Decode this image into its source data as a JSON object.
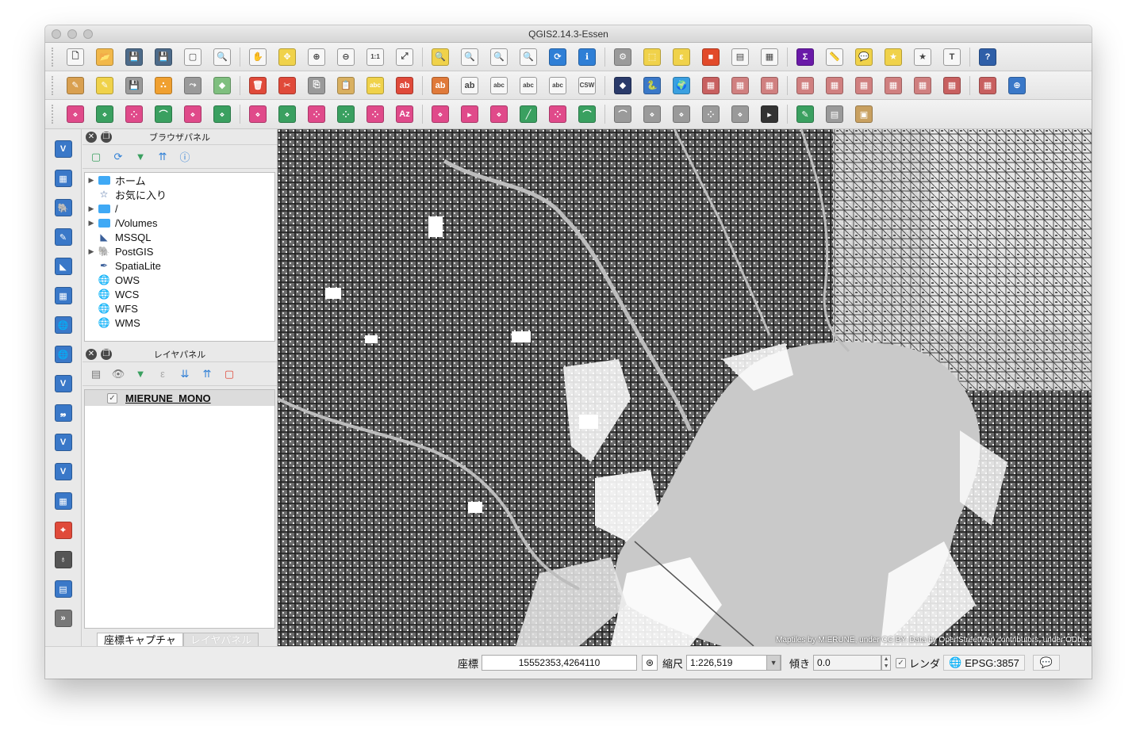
{
  "window": {
    "title": "QGIS2.14.3-Essen"
  },
  "toolbars": {
    "row1": [
      {
        "name": "new-project-icon",
        "glyph": "🗋",
        "color": "#ffffff"
      },
      {
        "name": "open-project-icon",
        "glyph": "📂",
        "color": "#f2b84a"
      },
      {
        "name": "save-project-icon",
        "glyph": "💾",
        "color": "#4d6b8a"
      },
      {
        "name": "save-as-icon",
        "glyph": "💾",
        "color": "#4d6b8a"
      },
      {
        "name": "new-print-composer-icon",
        "glyph": "▢",
        "color": "#ffffff"
      },
      {
        "name": "composer-manager-icon",
        "glyph": "🔍",
        "color": "#ffffff"
      },
      {
        "name": "pan-icon",
        "glyph": "✋",
        "color": "#ffffff"
      },
      {
        "name": "pan-to-selection-icon",
        "glyph": "✥",
        "color": "#f0d24a"
      },
      {
        "name": "zoom-in-icon",
        "glyph": "⊕",
        "color": "#ffffff"
      },
      {
        "name": "zoom-out-icon",
        "glyph": "⊖",
        "color": "#ffffff"
      },
      {
        "name": "zoom-native-icon",
        "glyph": "1:1",
        "color": "#ffffff"
      },
      {
        "name": "zoom-full-icon",
        "glyph": "⤢",
        "color": "#ffffff"
      },
      {
        "name": "zoom-to-selection-icon",
        "glyph": "🔍",
        "color": "#f0d24a"
      },
      {
        "name": "zoom-to-layer-icon",
        "glyph": "🔍",
        "color": "#ffffff"
      },
      {
        "name": "zoom-last-icon",
        "glyph": "🔍",
        "color": "#ffffff"
      },
      {
        "name": "zoom-next-icon",
        "glyph": "🔍",
        "color": "#ffffff"
      },
      {
        "name": "refresh-icon",
        "glyph": "⟳",
        "color": "#2f7fd6"
      },
      {
        "name": "identify-icon",
        "glyph": "ℹ",
        "color": "#2f7fd6"
      },
      {
        "name": "action-icon",
        "glyph": "⚙",
        "color": "#9a9a9a"
      },
      {
        "name": "select-features-icon",
        "glyph": "⬚",
        "color": "#f0d24a"
      },
      {
        "name": "select-by-expression-icon",
        "glyph": "ε",
        "color": "#f0d24a"
      },
      {
        "name": "deselect-icon",
        "glyph": "■",
        "color": "#e24a2a"
      },
      {
        "name": "attribute-table-icon",
        "glyph": "▤",
        "color": "#ffffff"
      },
      {
        "name": "field-calculator-icon",
        "glyph": "▦",
        "color": "#ffffff"
      },
      {
        "name": "statistics-icon",
        "glyph": "Σ",
        "color": "#6a1aa8"
      },
      {
        "name": "measure-icon",
        "glyph": "📏",
        "color": "#ffffff"
      },
      {
        "name": "map-tips-icon",
        "glyph": "💬",
        "color": "#f0d24a"
      },
      {
        "name": "new-bookmark-icon",
        "glyph": "★",
        "color": "#f0d24a"
      },
      {
        "name": "show-bookmarks-icon",
        "glyph": "★",
        "color": "#ffffff"
      },
      {
        "name": "text-annotation-icon",
        "glyph": "T",
        "color": "#ffffff"
      },
      {
        "name": "help-icon",
        "glyph": "?",
        "color": "#2f5fa8"
      }
    ],
    "row2": [
      {
        "name": "toggle-editing-icon",
        "glyph": "✎",
        "color": "#d9a050"
      },
      {
        "name": "current-edits-icon",
        "glyph": "✎",
        "color": "#f0d24a"
      },
      {
        "name": "save-edits-icon",
        "glyph": "💾",
        "color": "#9a9a9a"
      },
      {
        "name": "add-feature-icon",
        "glyph": "∴",
        "color": "#f0a030"
      },
      {
        "name": "move-feature-icon",
        "glyph": "⤳",
        "color": "#9a9a9a"
      },
      {
        "name": "node-tool-icon",
        "glyph": "◆",
        "color": "#7fbf7f"
      },
      {
        "name": "delete-selected-icon",
        "glyph": "🗑",
        "color": "#e04a3a"
      },
      {
        "name": "cut-features-icon",
        "glyph": "✂",
        "color": "#e04a3a"
      },
      {
        "name": "copy-features-icon",
        "glyph": "⎘",
        "color": "#9a9a9a"
      },
      {
        "name": "paste-features-icon",
        "glyph": "📋",
        "color": "#d9b060"
      },
      {
        "name": "label-toolbar-icon",
        "glyph": "abc",
        "color": "#f0d24a"
      },
      {
        "name": "label-highlight-icon",
        "glyph": "ab",
        "color": "#e04a3a"
      },
      {
        "name": "label-pin-icon",
        "glyph": "ab",
        "color": "#e07a3a"
      },
      {
        "name": "label-show-icon",
        "glyph": "ab",
        "color": "#ffffff"
      },
      {
        "name": "label-move-icon",
        "glyph": "abc",
        "color": "#ffffff"
      },
      {
        "name": "label-rotate-icon",
        "glyph": "abc",
        "color": "#ffffff"
      },
      {
        "name": "label-change-icon",
        "glyph": "abc",
        "color": "#ffffff"
      },
      {
        "name": "csw-icon",
        "glyph": "CSW",
        "color": "#ffffff"
      },
      {
        "name": "plugin-stamp-icon",
        "glyph": "◆",
        "color": "#2a3a6a"
      },
      {
        "name": "python-console-icon",
        "glyph": "🐍",
        "color": "#3a78c8"
      },
      {
        "name": "globe-plugin-icon",
        "glyph": "🌍",
        "color": "#3aa0e0"
      },
      {
        "name": "raster-plugin-1-icon",
        "glyph": "▦",
        "color": "#c86060"
      },
      {
        "name": "raster-plugin-2-icon",
        "glyph": "▦",
        "color": "#d08080"
      },
      {
        "name": "raster-plugin-3-icon",
        "glyph": "▦",
        "color": "#d08080"
      },
      {
        "name": "raster-plugin-4-icon",
        "glyph": "▦",
        "color": "#d08080"
      },
      {
        "name": "raster-plugin-5-icon",
        "glyph": "▦",
        "color": "#d08080"
      },
      {
        "name": "raster-plugin-6-icon",
        "glyph": "▦",
        "color": "#d08080"
      },
      {
        "name": "raster-plugin-7-icon",
        "glyph": "▦",
        "color": "#d08080"
      },
      {
        "name": "raster-plugin-8-icon",
        "glyph": "▦",
        "color": "#d08080"
      },
      {
        "name": "raster-plugin-9-icon",
        "glyph": "▦",
        "color": "#c86060"
      },
      {
        "name": "raster-plugin-10-icon",
        "glyph": "▦",
        "color": "#c86060"
      },
      {
        "name": "web-plugin-icon",
        "glyph": "⊕",
        "color": "#3a78c8"
      }
    ],
    "row3": [
      {
        "name": "digitize-1-icon",
        "glyph": "⋄",
        "color": "#e04a8a"
      },
      {
        "name": "digitize-2-icon",
        "glyph": "⋄",
        "color": "#3aa060"
      },
      {
        "name": "digitize-3-icon",
        "glyph": "⁘",
        "color": "#e04a8a"
      },
      {
        "name": "digitize-4-icon",
        "glyph": "⌒",
        "color": "#3aa060"
      },
      {
        "name": "digitize-5-icon",
        "glyph": "⋄",
        "color": "#e04a8a"
      },
      {
        "name": "digitize-6-icon",
        "glyph": "⋄",
        "color": "#3aa060"
      },
      {
        "name": "digitize-7-icon",
        "glyph": "⋄",
        "color": "#e04a8a"
      },
      {
        "name": "digitize-8-icon",
        "glyph": "⋄",
        "color": "#3aa060"
      },
      {
        "name": "digitize-9-icon",
        "glyph": "⁘",
        "color": "#e04a8a"
      },
      {
        "name": "digitize-10-icon",
        "glyph": "⁘",
        "color": "#3aa060"
      },
      {
        "name": "digitize-11-icon",
        "glyph": "⁘",
        "color": "#e04a8a"
      },
      {
        "name": "digitize-12-icon",
        "glyph": "Az",
        "color": "#e04a8a"
      },
      {
        "name": "digitize-13-icon",
        "glyph": "⋄",
        "color": "#e04a8a"
      },
      {
        "name": "digitize-14-icon",
        "glyph": "▸",
        "color": "#e04a8a"
      },
      {
        "name": "digitize-15-icon",
        "glyph": "⋄",
        "color": "#e04a8a"
      },
      {
        "name": "digitize-16-icon",
        "glyph": "╱",
        "color": "#3aa060"
      },
      {
        "name": "digitize-17-icon",
        "glyph": "⁘",
        "color": "#e04a8a"
      },
      {
        "name": "digitize-18-icon",
        "glyph": "⌒",
        "color": "#3aa060"
      },
      {
        "name": "digitize-19-icon",
        "glyph": "⌒",
        "color": "#9a9a9a"
      },
      {
        "name": "digitize-20-icon",
        "glyph": "⋄",
        "color": "#9a9a9a"
      },
      {
        "name": "digitize-21-icon",
        "glyph": "⋄",
        "color": "#9a9a9a"
      },
      {
        "name": "digitize-22-icon",
        "glyph": "⁘",
        "color": "#9a9a9a"
      },
      {
        "name": "digitize-23-icon",
        "glyph": "⋄",
        "color": "#9a9a9a"
      },
      {
        "name": "terminal-icon",
        "glyph": "▸",
        "color": "#333333"
      },
      {
        "name": "georeferencer-icon",
        "glyph": "✎",
        "color": "#3aa060"
      },
      {
        "name": "raster-terrain-icon",
        "glyph": "▤",
        "color": "#9a9a9a"
      },
      {
        "name": "image-icon",
        "glyph": "▣",
        "color": "#c8a060"
      }
    ],
    "left": [
      {
        "name": "add-vector-layer-icon",
        "glyph": "V",
        "color": "#3a78c8"
      },
      {
        "name": "add-raster-layer-icon",
        "glyph": "▦",
        "color": "#3a78c8"
      },
      {
        "name": "add-postgis-layer-icon",
        "glyph": "🐘",
        "color": "#3a78c8"
      },
      {
        "name": "add-spatialite-layer-icon",
        "glyph": "✎",
        "color": "#3a78c8"
      },
      {
        "name": "add-mssql-layer-icon",
        "glyph": "◣",
        "color": "#3a78c8"
      },
      {
        "name": "add-oracle-layer-icon",
        "glyph": "▦",
        "color": "#3a78c8"
      },
      {
        "name": "add-wms-layer-icon",
        "glyph": "🌐",
        "color": "#3a78c8"
      },
      {
        "name": "add-wcs-layer-icon",
        "glyph": "🌐",
        "color": "#3a78c8"
      },
      {
        "name": "add-wfs-layer-icon",
        "glyph": "V",
        "color": "#3a78c8"
      },
      {
        "name": "add-delimited-text-layer-icon",
        "glyph": "❠",
        "color": "#3a78c8"
      },
      {
        "name": "add-virtual-layer-icon",
        "glyph": "V",
        "color": "#3a78c8"
      },
      {
        "name": "new-shapefile-layer-icon",
        "glyph": "V",
        "color": "#3a78c8"
      },
      {
        "name": "new-spatialite-layer-icon",
        "glyph": "▦",
        "color": "#3a78c8"
      },
      {
        "name": "coordinate-capture-icon",
        "glyph": "⌖",
        "color": "#e04a3a"
      },
      {
        "name": "gps-tool-icon",
        "glyph": "♁",
        "color": "#555555"
      },
      {
        "name": "db-manager-icon",
        "glyph": "▤",
        "color": "#3a78c8"
      },
      {
        "name": "more-tools-chevron-icon",
        "glyph": "»",
        "color": "#777777"
      }
    ]
  },
  "browser_panel": {
    "title": "ブラウザパネル",
    "items": [
      {
        "label": "ホーム",
        "expandable": true,
        "icon": "folder-icon"
      },
      {
        "label": "お気に入り",
        "expandable": false,
        "icon": "star-icon"
      },
      {
        "label": "/",
        "expandable": true,
        "icon": "folder-icon"
      },
      {
        "label": "/Volumes",
        "expandable": true,
        "icon": "folder-icon"
      },
      {
        "label": "MSSQL",
        "expandable": false,
        "icon": "mssql-icon"
      },
      {
        "label": "PostGIS",
        "expandable": true,
        "icon": "postgis-elephant-icon"
      },
      {
        "label": "SpatiaLite",
        "expandable": false,
        "icon": "spatialite-feather-icon"
      },
      {
        "label": "OWS",
        "expandable": false,
        "icon": "ows-globe-icon"
      },
      {
        "label": "WCS",
        "expandable": false,
        "icon": "wcs-globe-icon"
      },
      {
        "label": "WFS",
        "expandable": false,
        "icon": "wfs-globe-icon"
      },
      {
        "label": "WMS",
        "expandable": false,
        "icon": "wms-globe-icon"
      }
    ]
  },
  "layer_panel": {
    "title": "レイヤパネル",
    "layers": [
      {
        "name": "MIERUNE_MONO",
        "checked": true
      }
    ]
  },
  "bottom_tabs": {
    "active": "座標キャプチャ",
    "inactive": "レイヤパネル"
  },
  "map": {
    "attribution": "Maptiles by MIERUNE, under CC BY. Data by OpenStreetMap contributors, under ODbL."
  },
  "status": {
    "coord_label": "座標",
    "coord_value": "15552353,4264110",
    "scale_label": "縮尺",
    "scale_value": "1:226,519",
    "rotation_label": "傾き",
    "rotation_value": "0.0",
    "render_label": "レンダ",
    "render_checked": true,
    "crs": "EPSG:3857"
  }
}
